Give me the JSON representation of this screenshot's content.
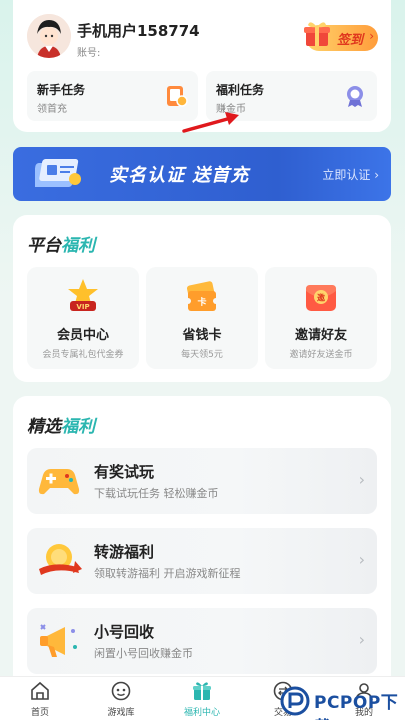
{
  "profile": {
    "username": "手机用户158774",
    "account_label": "账号:",
    "signin_label": "签到",
    "signin_chevron": "›"
  },
  "tasks": [
    {
      "title": "新手任务",
      "subtitle": "领首充",
      "icon": "phone-coin-icon"
    },
    {
      "title": "福利任务",
      "subtitle": "赚金币",
      "icon": "medal-icon"
    }
  ],
  "banner": {
    "text": "实名认证  送首充",
    "link": "立即认证 ›"
  },
  "platform": {
    "title_plain": "平台",
    "title_highlight": "福利",
    "tiles": [
      {
        "title": "会员中心",
        "subtitle": "会员专属礼包代金券",
        "icon": "vip-crown-icon",
        "badge": "VIP"
      },
      {
        "title": "省钱卡",
        "subtitle": "每天领5元",
        "icon": "ticket-card-icon",
        "badge": "卡"
      },
      {
        "title": "邀请好友",
        "subtitle": "邀请好友送金币",
        "icon": "red-envelope-icon",
        "badge": "邀"
      }
    ]
  },
  "selected": {
    "title_plain": "精选",
    "title_highlight": "福利",
    "rows": [
      {
        "title": "有奖试玩",
        "subtitle": "下载试玩任务 轻松赚金币",
        "icon": "gamepad-icon"
      },
      {
        "title": "转游福利",
        "subtitle": "领取转游福利 开启游戏新征程",
        "icon": "coin-transfer-icon"
      },
      {
        "title": "小号回收",
        "subtitle": "闲置小号回收赚金币",
        "icon": "megaphone-icon"
      }
    ],
    "chevron": "›"
  },
  "bottom_nav": [
    {
      "label": "首页",
      "icon": "home-icon",
      "active": false
    },
    {
      "label": "游戏库",
      "icon": "game-library-icon",
      "active": false
    },
    {
      "label": "福利中心",
      "icon": "gift-icon",
      "active": true
    },
    {
      "label": "交易",
      "icon": "trade-icon",
      "active": false
    },
    {
      "label": "我的",
      "icon": "profile-icon",
      "active": false
    }
  ],
  "watermark": {
    "text": "PCPOP下载"
  },
  "colors": {
    "accent": "#2bb6b0",
    "banner": "#3a6de0",
    "signin": "#ff9d3b",
    "arrow": "#e0191d"
  }
}
